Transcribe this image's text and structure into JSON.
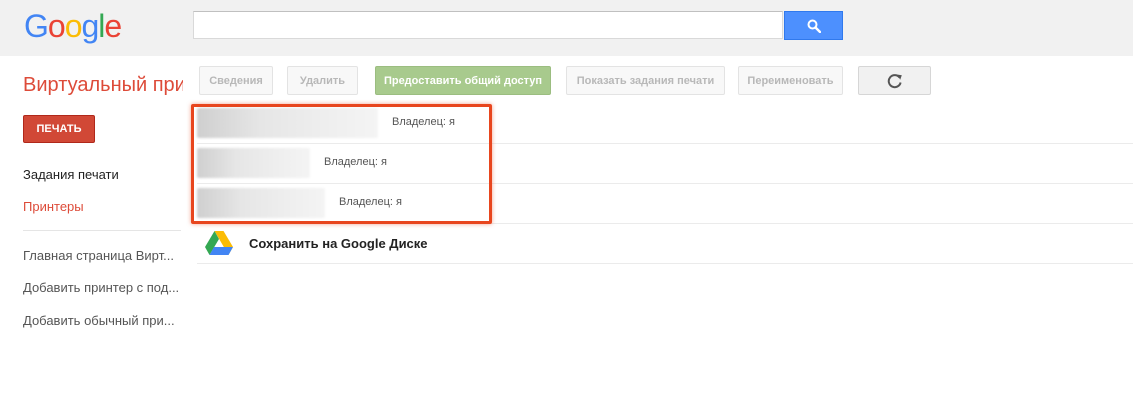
{
  "header": {
    "logo_letters": [
      {
        "char": "G",
        "color": "#4285f4"
      },
      {
        "char": "o",
        "color": "#ea4335"
      },
      {
        "char": "o",
        "color": "#fbbc05"
      },
      {
        "char": "g",
        "color": "#4285f4"
      },
      {
        "char": "l",
        "color": "#34a853"
      },
      {
        "char": "e",
        "color": "#ea4335"
      }
    ],
    "search": {
      "value": "",
      "placeholder": ""
    },
    "search_icon": "magnifier-icon"
  },
  "page_title": "Виртуальный при",
  "toolbar": {
    "details": "Сведения",
    "delete": "Удалить",
    "share": "Предоставить общий доступ",
    "show_jobs": "Показать задания печати",
    "rename": "Переименовать",
    "refresh_icon": "refresh-icon"
  },
  "sidebar": {
    "print_button": "ПЕЧАТЬ",
    "print_jobs": "Задания печати",
    "printers": "Принтеры",
    "links": [
      "Главная страница Вирт...",
      "Добавить принтер с под...",
      "Добавить обычный при..."
    ]
  },
  "printers": [
    {
      "name": "",
      "owner": "Владелец: я"
    },
    {
      "name": "",
      "owner": "Владелец: я"
    },
    {
      "name": "",
      "owner": "Владелец: я"
    }
  ],
  "drive_row": {
    "label": "Сохранить на Google Диске",
    "icon": "google-drive-icon"
  },
  "colors": {
    "accent_red": "#dd4b39",
    "print_button": "#d14836",
    "search_blue": "#4d90fe",
    "share_green": "#a8ca8d",
    "highlight": "#e8461e"
  }
}
